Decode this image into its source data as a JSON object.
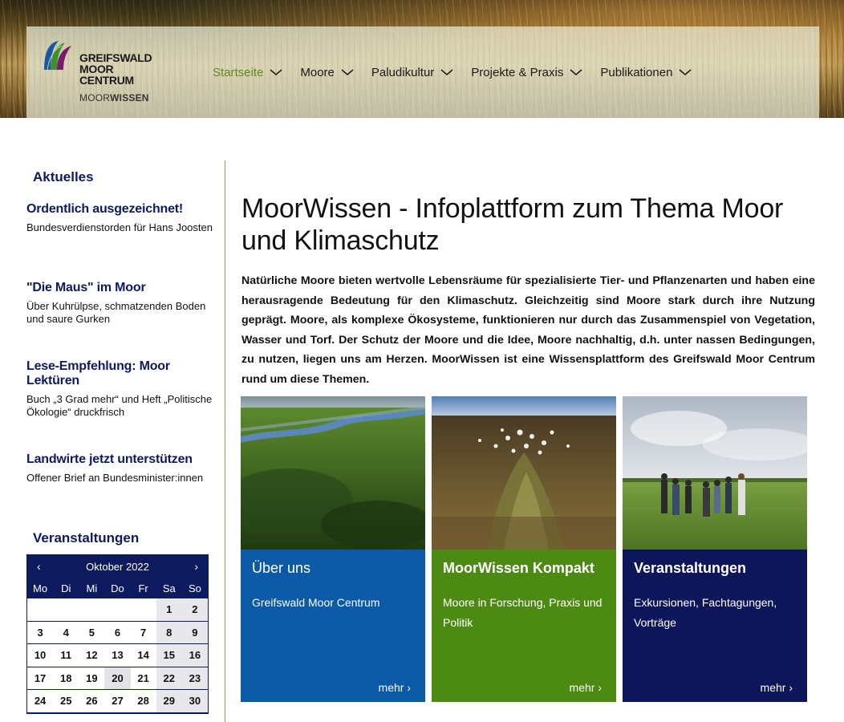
{
  "logo": {
    "line1": "GREIFSWALD",
    "line2": "MOOR",
    "line3": "CENTRUM",
    "sub_a": "MOOR",
    "sub_b": "WISSEN"
  },
  "nav": [
    {
      "label": "Startseite",
      "active": true
    },
    {
      "label": "Moore"
    },
    {
      "label": "Paludikultur"
    },
    {
      "label": "Projekte & Praxis"
    },
    {
      "label": "Publikationen"
    }
  ],
  "sidebar": {
    "news_heading": "Aktuelles",
    "news": [
      {
        "title": "Ordentlich ausgezeichnet!",
        "text": "Bundesverdienstorden für Hans Joosten"
      },
      {
        "title": "\"Die Maus\" im Moor",
        "text": "Über Kuhrülpse, schmatzenden Boden und saure Gurken"
      },
      {
        "title": "Lese-Empfehlung: Moor Lektüren",
        "text": "Buch „3 Grad mehr“ und Heft „Politische Ökologie“ druckfrisch"
      },
      {
        "title": "Landwirte jetzt unterstützen",
        "text": "Offener Brief an Bundesminister:innen"
      }
    ],
    "events_heading": "Veranstaltungen"
  },
  "calendar": {
    "prev": "‹",
    "next": "›",
    "month": "Oktober 2022",
    "weekdays": [
      "Mo",
      "Di",
      "Mi",
      "Do",
      "Fr",
      "Sa",
      "So"
    ],
    "days": [
      "",
      "",
      "",
      "",
      "",
      "1",
      "2",
      "3",
      "4",
      "5",
      "6",
      "7",
      "8",
      "9",
      "10",
      "11",
      "12",
      "13",
      "14",
      "15",
      "16",
      "17",
      "18",
      "19",
      "20",
      "21",
      "22",
      "23",
      "24",
      "25",
      "26",
      "27",
      "28",
      "29",
      "30"
    ],
    "today": "20"
  },
  "main": {
    "title": "MoorWissen - Infoplattform zum Thema Moor und Klimaschutz",
    "intro": "Natürliche Moore bieten wertvolle Lebensräume für spezialisierte Tier- und Pflanzenarten und haben eine herausragende Bedeutung für den Klimaschutz. Gleichzeitig sind Moore stark durch ihre Nutzung geprägt. Moore, als komplexe Ökosysteme, funktionieren nur durch das Zusammenspiel von Vegetation, Wasser und Torf. Der Schutz der Moore und die Idee, Moore nachhaltig, d.h. unter nassen Bedingungen, zu nutzen, liegen uns am Herzen. MoorWissen ist eine Wissensplattform des Greifswald Moor Centrum rund um diese Themen."
  },
  "cards": [
    {
      "title": "Über uns",
      "subtitle": "Greifswald Moor Centrum",
      "more": "mehr ›",
      "color": "#0b5aa8"
    },
    {
      "title": "MoorWissen Kompakt",
      "subtitle": "Moore in Forschung, Praxis und Politik",
      "more": "mehr ›",
      "color": "#4d8a14"
    },
    {
      "title": "Veranstaltungen",
      "subtitle": "Exkursionen, Fachtagungen, Vorträge",
      "more": "mehr ›",
      "color": "#0d1658"
    }
  ],
  "colors": {
    "navy": "#0d1b5e",
    "green_accent": "#5e8c1c",
    "divider": "#7aa53a"
  }
}
